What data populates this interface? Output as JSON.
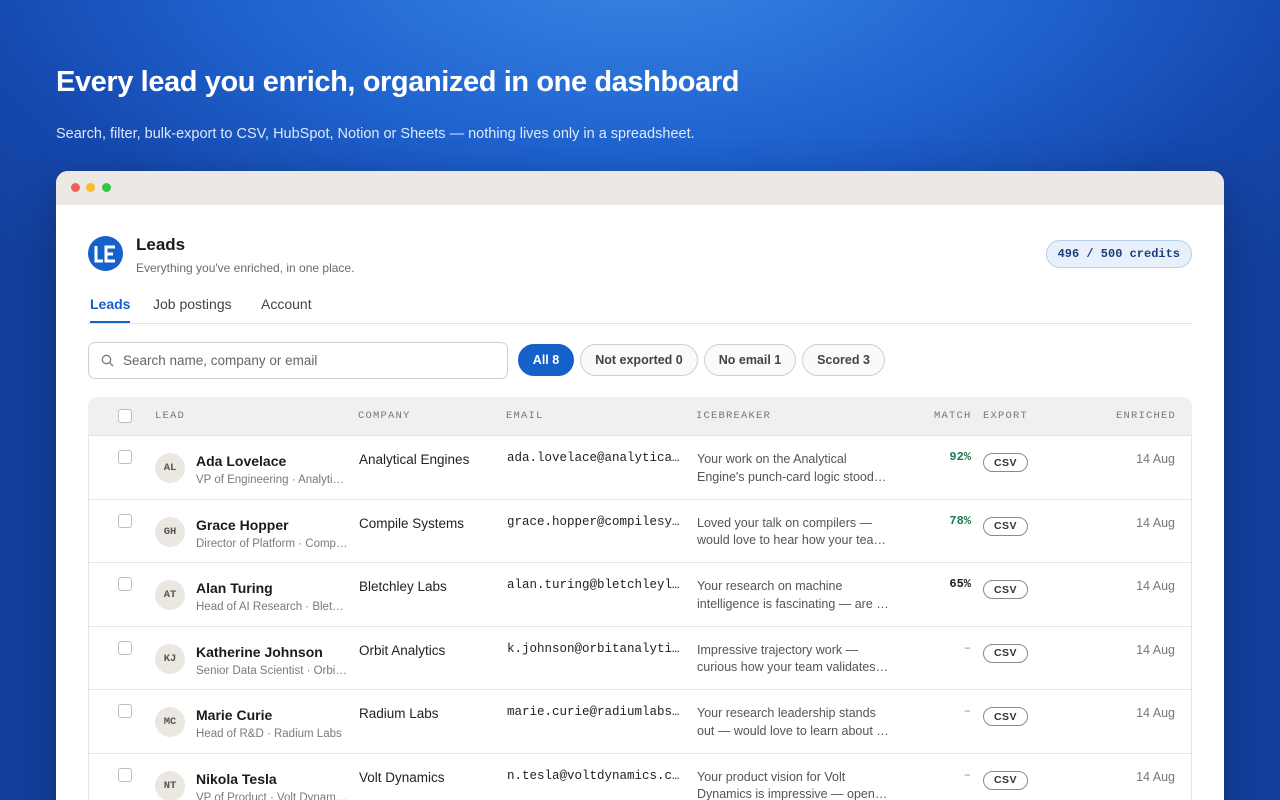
{
  "hero": {
    "title": "Every lead you enrich, organized in one dashboard",
    "subtitle": "Search, filter, bulk-export to CSV, HubSpot, Notion or Sheets — nothing lives only in a spreadsheet."
  },
  "app": {
    "logo_text": "LE",
    "name": "Leads",
    "subtitle": "Everything you've enriched, in one place.",
    "credits": "496 / 500 credits"
  },
  "tabs": [
    {
      "label": "Leads",
      "active": true
    },
    {
      "label": "Job postings",
      "active": false
    },
    {
      "label": "Account",
      "active": false
    }
  ],
  "search": {
    "placeholder": "Search name, company or email",
    "value": ""
  },
  "filters": [
    {
      "label": "All 8",
      "active": true
    },
    {
      "label": "Not exported 0",
      "active": false
    },
    {
      "label": "No email 1",
      "active": false
    },
    {
      "label": "Scored 3",
      "active": false
    }
  ],
  "columns": {
    "lead": "LEAD",
    "company": "COMPANY",
    "email": "EMAIL",
    "icebreaker": "ICEBREAKER",
    "match": "MATCH",
    "export": "EXPORT",
    "enriched": "ENRICHED"
  },
  "rows": [
    {
      "initials": "AL",
      "name": "Ada Lovelace",
      "title": "VP of Engineering · Analytical Engines",
      "company": "Analytical Engines",
      "email": "ada.lovelace@analyticalengines.com",
      "ice1": "Your work on the Analytical",
      "ice2": "Engine's punch-card logic stood out to me",
      "match": "92%",
      "export": "CSV",
      "date": "14 Aug"
    },
    {
      "initials": "GH",
      "name": "Grace Hopper",
      "title": "Director of Platform · Compile Systems",
      "company": "Compile Systems",
      "email": "grace.hopper@compilesystems.com",
      "ice1": "Loved your talk on compilers —",
      "ice2": "would love to hear how your team ships",
      "match": "78%",
      "export": "CSV",
      "date": "14 Aug"
    },
    {
      "initials": "AT",
      "name": "Alan Turing",
      "title": "Head of AI Research · Bletchley Labs",
      "company": "Bletchley Labs",
      "email": "alan.turing@bletchleylabs.com",
      "ice1": "Your research on machine",
      "ice2": "intelligence is fascinating — are you hiring",
      "match": "65%",
      "export": "CSV",
      "date": "14 Aug"
    },
    {
      "initials": "KJ",
      "name": "Katherine Johnson",
      "title": "Senior Data Scientist · Orbit Analytics",
      "company": "Orbit Analytics",
      "email": "k.johnson@orbitanalytics.com",
      "ice1": "Impressive trajectory work —",
      "ice2": "curious how your team validates models",
      "match": "–",
      "export": "CSV",
      "date": "14 Aug"
    },
    {
      "initials": "MC",
      "name": "Marie Curie",
      "title": "Head of R&D · Radium Labs",
      "company": "Radium Labs",
      "email": "marie.curie@radiumlabs.com",
      "ice1": "Your research leadership stands",
      "ice2": "out — would love to learn about your roadmap",
      "match": "–",
      "export": "CSV",
      "date": "14 Aug"
    },
    {
      "initials": "NT",
      "name": "Nikola Tesla",
      "title": "VP of Product · Volt Dynamics",
      "company": "Volt Dynamics",
      "email": "n.tesla@voltdynamics.com",
      "ice1": "Your product vision for Volt",
      "ice2": "Dynamics is impressive — open to a chat",
      "match": "–",
      "export": "CSV",
      "date": "14 Aug"
    }
  ],
  "colors": {
    "accent": "#1560c9",
    "match_good": "#1e7a4e",
    "titlebar": "#ece9e4"
  }
}
